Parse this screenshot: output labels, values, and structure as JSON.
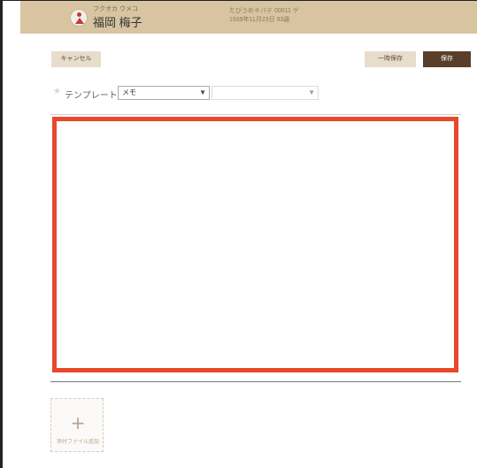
{
  "colors": {
    "header_bg": "#d8c4a0",
    "accent_red": "#e8472a",
    "save_button": "#5a3e28",
    "secondary_button": "#e8dccb"
  },
  "patient": {
    "kana": "フクオカ ウメコ",
    "name": "福岡 梅子",
    "meta_line1": "たびうめキバテ 00011 ゲ",
    "meta_line2": "1939年11月23日 93歳",
    "avatar_icon": "person-icon"
  },
  "toolbar": {
    "cancel_label": "キャンセル",
    "temp_save_label": "一時保存",
    "save_label": "保存"
  },
  "template": {
    "star_icon": "star-icon",
    "label": "テンプレート：",
    "select1_value": "メモ",
    "select2_value": ""
  },
  "attachment": {
    "plus_icon": "plus-icon",
    "label": "添付ファイル追加"
  }
}
